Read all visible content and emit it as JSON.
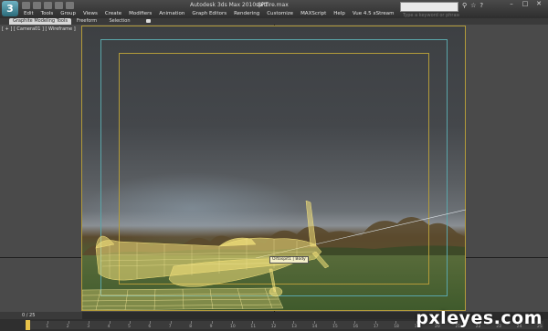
{
  "titlebar": {
    "app_logo": "3",
    "title": "Autodesk 3ds Max 2010 SP1",
    "file": "spitfire.max",
    "search_placeholder": "Type a keyword or phrase",
    "icons": [
      "binoculars-icon",
      "star-icon",
      "help-icon"
    ],
    "window_controls": [
      "–",
      "□",
      "✕"
    ]
  },
  "menubar": {
    "items": [
      "Edit",
      "Tools",
      "Group",
      "Views",
      "Create",
      "Modifiers",
      "Animation",
      "Graph Editors",
      "Rendering",
      "Customize",
      "MAXScript",
      "Help",
      "Vue 4.5 xStream"
    ]
  },
  "ribbon": {
    "tabs": [
      "Graphite Modeling Tools",
      "Freeform",
      "Selection"
    ],
    "active_tab": 0
  },
  "viewport": {
    "label": "[ + ] [ Camera01 ] [ Wireframe ]",
    "tooltip": "Ortospit1 | Body"
  },
  "status": {
    "frame_counter": "0 / 25"
  },
  "timeline": {
    "current_frame": 0,
    "ticks": [
      "0",
      "1",
      "2",
      "3",
      "4",
      "5",
      "6",
      "7",
      "8",
      "9",
      "10",
      "11",
      "12",
      "13",
      "14",
      "15",
      "16",
      "17",
      "18",
      "19",
      "20",
      "21",
      "22",
      "23",
      "24",
      "25"
    ]
  },
  "watermark": "pxleyes.com",
  "colors": {
    "accent_yellow": "#e8c24a",
    "safe_frame_cyan": "#5aa6aa",
    "safe_frame_yellow": "#b39b3a",
    "wireframe": "#f2e07a"
  }
}
